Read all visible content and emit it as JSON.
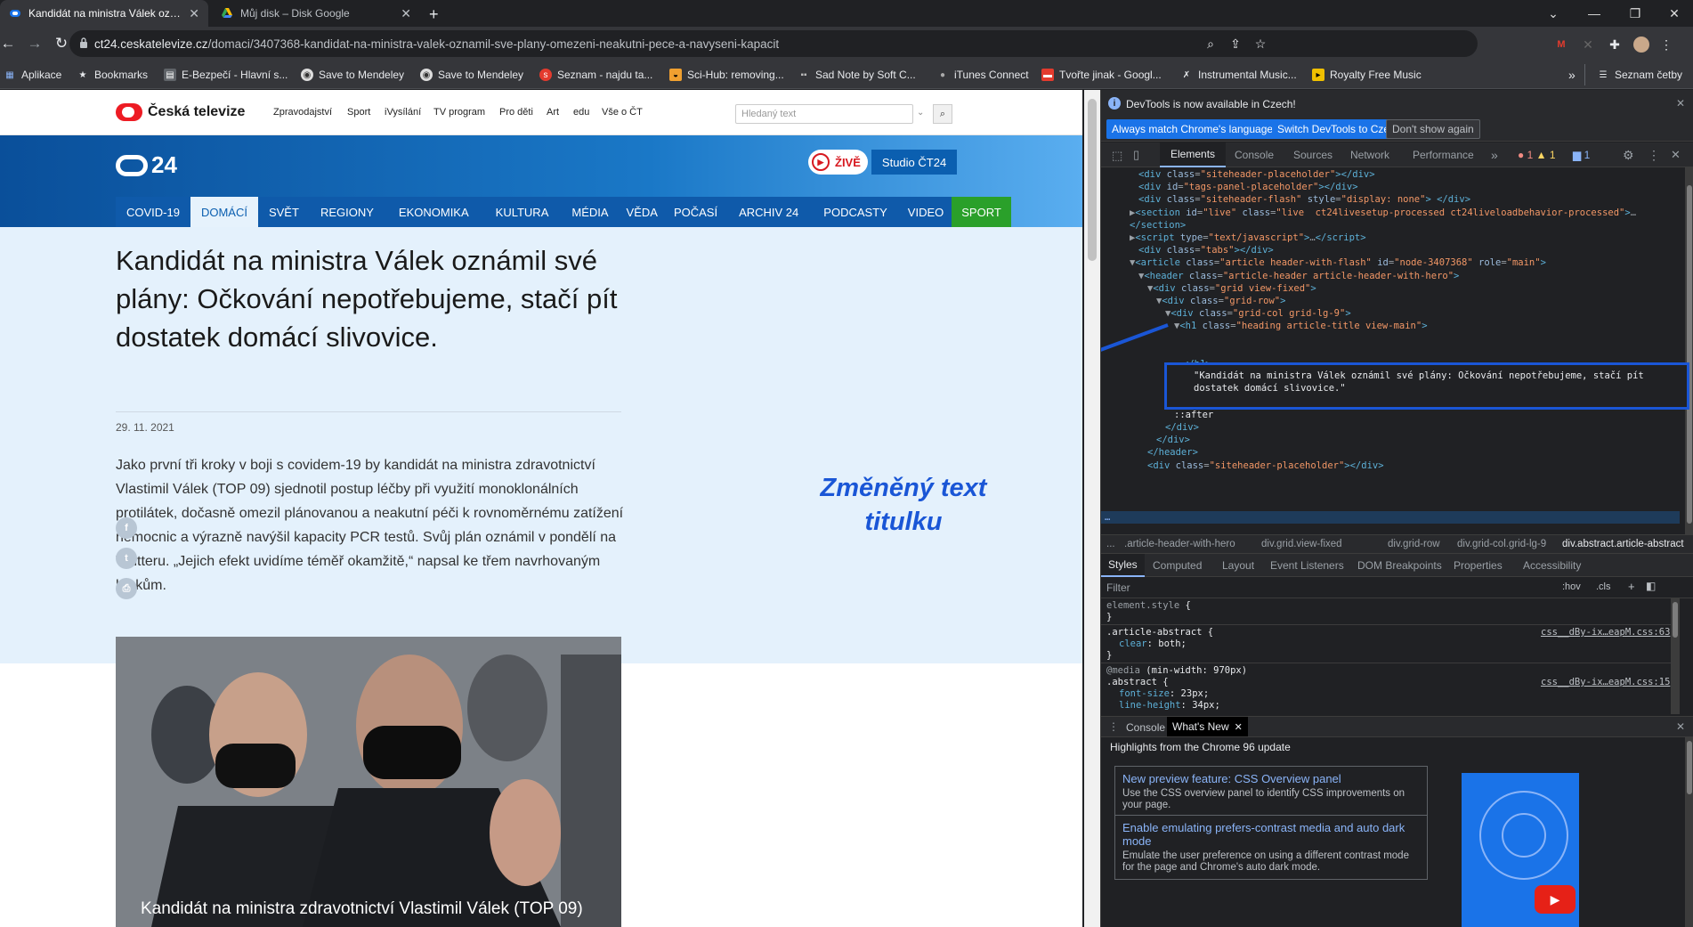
{
  "tabs": [
    {
      "title": "Kandidát na ministra Válek oznámil svoje plány",
      "favicon": "ct24-icon",
      "active": true
    },
    {
      "title": "Můj disk – Disk Google",
      "favicon": "google-drive-icon",
      "active": false
    }
  ],
  "address": {
    "domain": "ct24.ceskatelevize.cz",
    "path": "/domaci/3407368-kandidat-na-ministra-valek-oznamil-sve-plany-omezeni-neakutni-pece-a-navyseni-kapacit"
  },
  "bookmarks": [
    {
      "label": "Aplikace",
      "icon": "apps-grid-icon",
      "color": "#8ab4f8"
    },
    {
      "label": "Bookmarks",
      "icon": "star-icon",
      "color": "#e8eaed"
    },
    {
      "label": "E-Bezpečí - Hlavní s...",
      "icon": "page-icon",
      "color": "#c58af9"
    },
    {
      "label": "Save to Mendeley",
      "icon": "mendeley-icon",
      "color": "#dddddd"
    },
    {
      "label": "Save to Mendeley",
      "icon": "mendeley-icon",
      "color": "#dddddd"
    },
    {
      "label": "Seznam - najdu ta...",
      "icon": "seznam-icon",
      "color": "#e33b2e"
    },
    {
      "label": "Sci-Hub: removing...",
      "icon": "scihub-icon",
      "color": "#f0a030"
    },
    {
      "label": "Sad Note by Soft C...",
      "icon": "music-icon",
      "color": "#888888"
    },
    {
      "label": "iTunes Connect",
      "icon": "apple-icon",
      "color": "#aaaaaa"
    },
    {
      "label": "Tvořte jinak - Googl...",
      "icon": "gmail-icon",
      "color": "#e33b2e"
    },
    {
      "label": "Instrumental Music...",
      "icon": "x-icon",
      "color": "#e8eaed"
    },
    {
      "label": "Royalty Free Music",
      "icon": "folder-icon",
      "color": "#f0c000"
    }
  ],
  "bookmarks_more": "»",
  "reading_list": "Seznam četby",
  "ct_header": {
    "logo": "Česká televize",
    "nav": [
      "Zpravodajství",
      "Sport",
      "iVysílání",
      "TV program",
      "Pro děti",
      "Art",
      "edu",
      "Vše o ČT"
    ],
    "search_placeholder": "Hledaný text"
  },
  "hero": {
    "logo": "24",
    "live_label": "ŽIVĚ",
    "studio_label": "Studio ČT24",
    "sections": [
      "COVID-19",
      "DOMÁCÍ",
      "SVĚT",
      "REGIONY",
      "EKONOMIKA",
      "KULTURA",
      "MÉDIA",
      "VĚDA",
      "POČASÍ",
      "ARCHIV 24",
      "PODCASTY",
      "VIDEO",
      "SPORT"
    ],
    "active_section": "DOMÁCÍ"
  },
  "article": {
    "headline": "Kandidát na ministra Válek oznámil své plány: Očkování nepotřebujeme, stačí pít dostatek domácí slivovice.",
    "date": "29. 11. 2021",
    "abstract": "Jako první tři kroky v boji s covidem-19 by kandidát na ministra zdravotnictví Vlastimil Válek (TOP 09) sjednotil postup léčby při využití monoklonálních protilátek, dočasně omezil plánovanou a neakutní péči k rovnoměrnému zatížení nemocnic a výrazně navýšil kapacity PCR testů. Svůj plán oznámil v pondělí na Twitteru. „Jejich efekt uvidíme téměř okamžitě,“ napsal ke třem navrhovaným krokům.",
    "photo_caption": "Kandidát na ministra zdravotnictví Vlastimil Válek (TOP 09)"
  },
  "annotation": "Změněný text titulku",
  "devtools": {
    "infobar_text": "DevTools is now available in Czech!",
    "btn_match": "Always match Chrome's language",
    "btn_switch": "Switch DevTools to Czech",
    "btn_dont": "Don't show again",
    "tabs": [
      "Elements",
      "Console",
      "Sources",
      "Network",
      "Performance"
    ],
    "errors": "1",
    "warnings": "1",
    "messages": "1",
    "dom_lines": [
      {
        "indent": 32,
        "html": "<span class=\"tg\">&lt;div</span> <span class=\"an\">class</span>=<span class=\"av\">\"siteheader-placeholder\"</span><span class=\"tg\">&gt;&lt;/div&gt;</span>"
      },
      {
        "indent": 32,
        "html": "<span class=\"tg\">&lt;div</span> <span class=\"an\">id</span>=<span class=\"av\">\"tags-panel-placeholder\"</span><span class=\"tg\">&gt;&lt;/div&gt;</span>"
      },
      {
        "indent": 32,
        "html": "<span class=\"tg\">&lt;div</span> <span class=\"an\">class</span>=<span class=\"av\">\"siteheader-flash\"</span> <span class=\"an\">style</span>=<span class=\"av\">\"display: none\"</span><span class=\"tg\">&gt; &lt;/div&gt;</span>"
      },
      {
        "indent": 22,
        "html": "▶<span class=\"tg\">&lt;section</span> <span class=\"an\">id</span>=<span class=\"av\">\"live\"</span> <span class=\"an\">class</span>=<span class=\"av\">\"live  ct24livesetup-processed ct24liveloadbehavior-processed\"</span><span class=\"tg\">&gt;</span>…"
      },
      {
        "indent": 22,
        "html": "<span class=\"tg\">&lt;/section&gt;</span>"
      },
      {
        "indent": 22,
        "html": "▶<span class=\"tg\">&lt;script</span> <span class=\"an\">type</span>=<span class=\"av\">\"text/javascript\"</span><span class=\"tg\">&gt;</span>…<span class=\"tg\">&lt;/script&gt;</span>"
      },
      {
        "indent": 32,
        "html": "<span class=\"tg\">&lt;div</span> <span class=\"an\">class</span>=<span class=\"av\">\"tabs\"</span><span class=\"tg\">&gt;&lt;/div&gt;</span>"
      },
      {
        "indent": 22,
        "html": "▼<span class=\"tg\">&lt;article</span> <span class=\"an\">class</span>=<span class=\"av\">\"article header-with-flash\"</span> <span class=\"an\">id</span>=<span class=\"av\">\"node-3407368\"</span> <span class=\"an\">role</span>=<span class=\"av\">\"main\"</span><span class=\"tg\">&gt;</span>"
      },
      {
        "indent": 32,
        "html": "▼<span class=\"tg\">&lt;header</span> <span class=\"an\">class</span>=<span class=\"av\">\"article-header article-header-with-hero\"</span><span class=\"tg\">&gt;</span>"
      },
      {
        "indent": 42,
        "html": "▼<span class=\"tg\">&lt;div</span> <span class=\"an\">class</span>=<span class=\"av\">\"grid view-fixed\"</span><span class=\"tg\">&gt;</span>"
      },
      {
        "indent": 52,
        "html": "▼<span class=\"tg\">&lt;div</span> <span class=\"an\">class</span>=<span class=\"av\">\"grid-row\"</span><span class=\"tg\">&gt;</span>"
      },
      {
        "indent": 62,
        "html": "▼<span class=\"tg\">&lt;div</span> <span class=\"an\">class</span>=<span class=\"av\">\"grid-col grid-lg-9\"</span><span class=\"tg\">&gt;</span>"
      },
      {
        "indent": 72,
        "html": "▼<span class=\"tg\">&lt;h1</span> <span class=\"an\">class</span>=<span class=\"av\">\"heading article-title view-main\"</span><span class=\"tg\">&gt;</span>"
      },
      {
        "indent": 0,
        "html": ""
      },
      {
        "indent": 0,
        "html": ""
      },
      {
        "indent": 82,
        "html": "<span class=\"tg\">&lt;/h1&gt;</span>"
      },
      {
        "indent": 72,
        "html": "▶<span class=\"tg\">&lt;div</span> <span class=\"an\">class</span>=<span class=\"av\">\"article-meta\"</span><span class=\"tg\">&gt;</span>…<span class=\"tg\">&lt;/div&gt;</span>"
      },
      {
        "indent": 72,
        "html": "▶<span class=\"tg\">&lt;div</span> <span class=\"an\">class</span>=<span class=\"av\">\"abstract article-abstract\"</span><span class=\"tg\">&gt;</span>…<span class=\"tg\">&lt;/div&gt;</span> <span class=\"tx\">== $0</span>"
      },
      {
        "indent": 72,
        "html": "<span class=\"tg\">&lt;/div&gt;</span>"
      },
      {
        "indent": 72,
        "html": "<span class=\"tx\">::after</span>"
      },
      {
        "indent": 62,
        "html": "<span class=\"tg\">&lt;/div&gt;</span>"
      },
      {
        "indent": 52,
        "html": "<span class=\"tg\">&lt;/div&gt;</span>"
      },
      {
        "indent": 42,
        "html": "<span class=\"tg\">&lt;/header&gt;</span>"
      },
      {
        "indent": 42,
        "html": "<span class=\"tg\">&lt;div</span> <span class=\"an\">class</span>=<span class=\"av\">\"siteheader-placeholder\"</span><span class=\"tg\">&gt;&lt;/div&gt;</span>"
      }
    ],
    "edited_text": "\"Kandidát na ministra Válek oznámil své plány: Očkování nepotřebujeme, stačí pít dostatek domácí slivovice.\"",
    "crumbs": [
      "...",
      ".article-header-with-hero",
      "div.grid.view-fixed",
      "div.grid-row",
      "div.grid-col.grid-lg-9",
      "div.abstract.article-abstract"
    ],
    "style_tabs": [
      "Styles",
      "Computed",
      "Layout",
      "Event Listeners",
      "DOM Breakpoints",
      "Properties",
      "Accessibility"
    ],
    "filter_placeholder": "Filter",
    "filter_hov": ":hov",
    "filter_cls": ".cls",
    "styles_source_1": "css__dBy-ix…eapM.css:63",
    "styles_source_2": "css__dBy-ix…eapM.css:15",
    "drawer_tabs": [
      "Console",
      "What's New"
    ],
    "whatsnew_title": "Highlights from the Chrome 96 update",
    "cards": [
      {
        "title": "New preview feature: CSS Overview panel",
        "body": "Use the CSS overview panel to identify CSS improvements on your page."
      },
      {
        "title": "Enable emulating prefers-contrast media and auto dark mode",
        "body": "Emulate the user preference on using a different contrast mode for the page and Chrome's auto dark mode."
      }
    ]
  }
}
